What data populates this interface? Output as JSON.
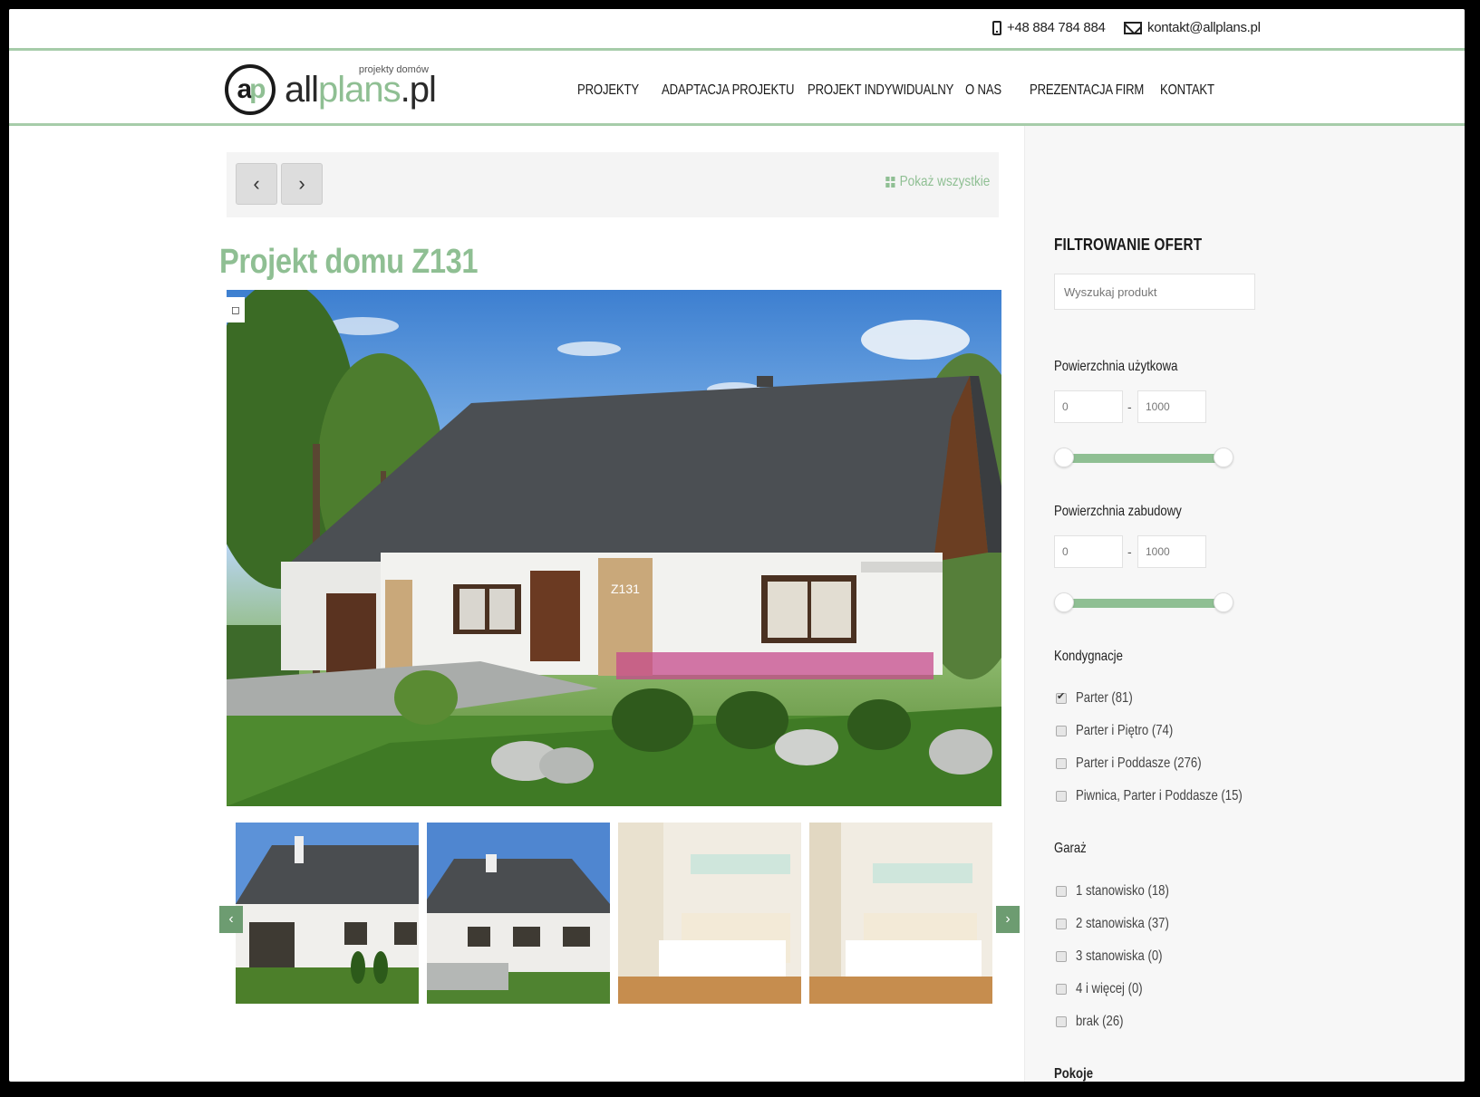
{
  "topbar": {
    "phone": "+48 884 784 884",
    "email": "kontakt@allplans.pl"
  },
  "logo": {
    "mark_a": "a",
    "mark_p": "p",
    "word_all": "all",
    "word_plans": "plans",
    "word_pl": ".pl",
    "tagline": "projekty domów"
  },
  "nav": {
    "items": [
      "PROJEKTY",
      "ADAPTACJA PROJEKTU",
      "PROJEKT INDYWIDUALNY",
      "O NAS",
      "PREZENTACJA FIRM",
      "KONTAKT"
    ]
  },
  "pager": {
    "prev": "‹",
    "next": "›",
    "show_all": "Pokaż wszystkie"
  },
  "product": {
    "title": "Projekt domu Z131",
    "house_sign": "Z131",
    "fullscreen_icon": "fullscreen-icon"
  },
  "carousel": {
    "prev": "‹",
    "next": "›",
    "thumbs": [
      "exterior-back",
      "exterior-side",
      "bedroom-1",
      "bedroom-2"
    ]
  },
  "sidebar": {
    "title": "FILTROWANIE OFERT",
    "search_placeholder": "Wyszukaj produkt",
    "area_usable": {
      "label": "Powierzchnia użytkowa",
      "min": "0",
      "max": "1000",
      "dash": "-"
    },
    "area_built": {
      "label": "Powierzchnia zabudowy",
      "min": "0",
      "max": "1000",
      "dash": "-"
    },
    "floors": {
      "label": "Kondygnacje",
      "options": [
        {
          "label": "Parter (81)",
          "checked": true
        },
        {
          "label": "Parter i Piętro (74)",
          "checked": false
        },
        {
          "label": "Parter i Poddasze (276)",
          "checked": false
        },
        {
          "label": "Piwnica, Parter i Poddasze (15)",
          "checked": false
        }
      ]
    },
    "garage": {
      "label": "Garaż",
      "options": [
        {
          "label": "1 stanowisko (18)",
          "checked": false
        },
        {
          "label": "2 stanowiska (37)",
          "checked": false
        },
        {
          "label": "3 stanowiska (0)",
          "checked": false
        },
        {
          "label": "4 i więcej (0)",
          "checked": false
        },
        {
          "label": "brak (26)",
          "checked": false
        }
      ]
    },
    "rooms": {
      "label": "Pokoje"
    }
  },
  "colors": {
    "accent": "#8fbf93",
    "accent_dark": "#6d9c71"
  }
}
